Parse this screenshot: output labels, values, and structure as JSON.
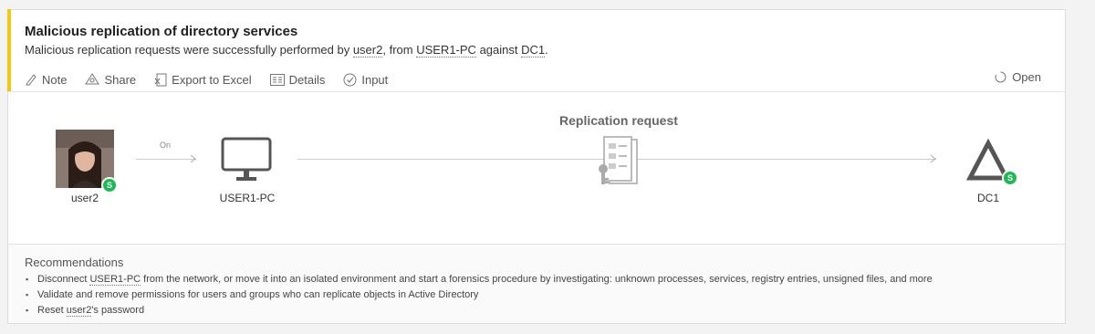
{
  "alert": {
    "title": "Malicious replication of directory services",
    "subtitle_parts": {
      "p1": "Malicious replication requests were successfully performed by ",
      "user": "user2",
      "p2": ", from ",
      "source": "USER1-PC",
      "p3": " against ",
      "target": "DC1",
      "p4": "."
    },
    "accent_color": "#f2c811"
  },
  "toolbar": {
    "note": "Note",
    "share": "Share",
    "export": "Export to Excel",
    "details": "Details",
    "input": "Input",
    "status": "Open"
  },
  "graph": {
    "user_label": "user2",
    "user_badge": "S",
    "on_label": "On",
    "computer_label": "USER1-PC",
    "activity_title": "Replication request",
    "dc_label": "DC1",
    "dc_badge": "S",
    "badge_color": "#1db954"
  },
  "recommendations": {
    "title": "Recommendations",
    "item1_pre": "Disconnect ",
    "item1_link": "USER1-PC",
    "item1_post": " from the network, or move it into an isolated environment and start a forensics procedure by investigating: unknown processes, services, registry entries, unsigned files, and more",
    "item2": "Validate and remove permissions for users and groups who can replicate objects in Active Directory",
    "item3_pre": "Reset ",
    "item3_link": "user2",
    "item3_post": "'s password"
  }
}
